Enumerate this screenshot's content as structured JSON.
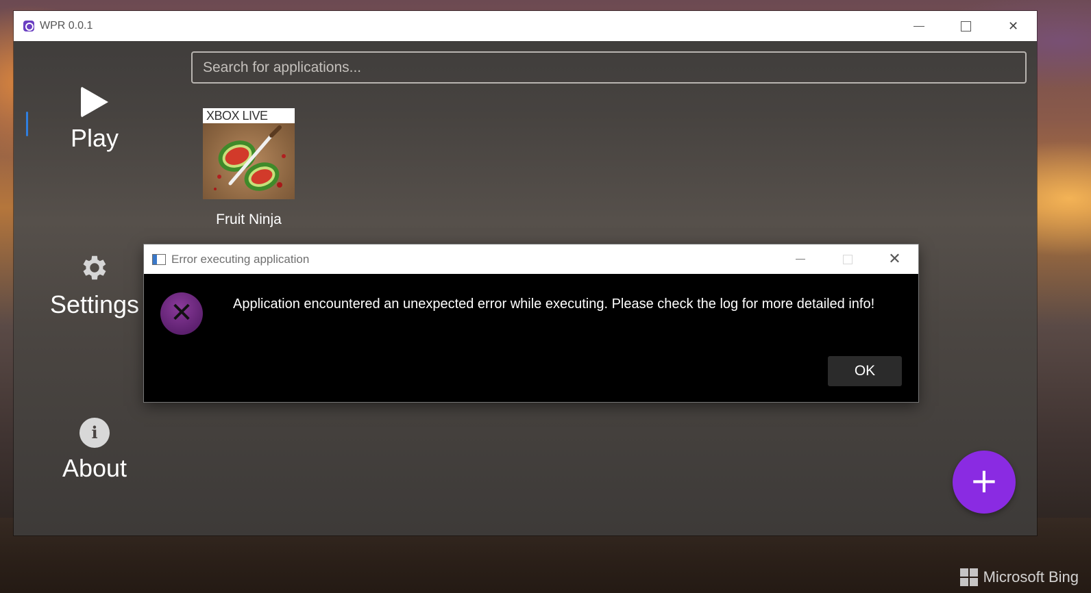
{
  "window": {
    "title": "WPR 0.0.1"
  },
  "sidebar": {
    "items": [
      {
        "label": "Play",
        "icon": "play-icon",
        "selected": true
      },
      {
        "label": "Settings",
        "icon": "gear-icon",
        "selected": false
      },
      {
        "label": "About",
        "icon": "info-icon",
        "selected": false
      }
    ]
  },
  "search": {
    "placeholder": "Search for applications..."
  },
  "apps": [
    {
      "name": "Fruit Ninja",
      "badge": "XBOX LIVE"
    }
  ],
  "fab": {
    "label": "+",
    "color": "#8a2be2"
  },
  "dialog": {
    "title": "Error executing application",
    "message": "Application encountered an unexpected error while executing. Please check the log for more detailed info!",
    "ok_label": "OK",
    "icon": "error-x-icon"
  },
  "desktop": {
    "watermark": "Microsoft Bing"
  },
  "colors": {
    "accent": "#8a2be2",
    "nav_indicator": "#2f7fe0"
  }
}
